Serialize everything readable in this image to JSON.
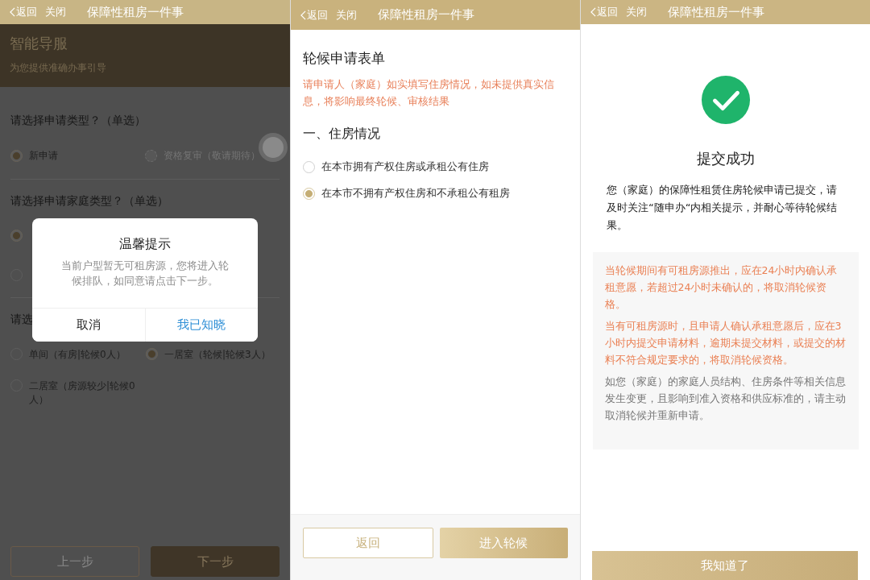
{
  "guide_screen": {
    "header": {
      "back": "返回",
      "close": "关闭",
      "title": "保障性租房一件事"
    },
    "banner": {
      "title": "智能导服",
      "subtitle": "为您提供准确办事引导"
    },
    "questions": [
      {
        "label": "请选择申请类型？（单选）",
        "options": [
          {
            "label": "新申请",
            "selected": true,
            "disabled": false
          },
          {
            "label": "资格复审（敬请期待）",
            "selected": false,
            "disabled": true
          }
        ]
      },
      {
        "label": "请选择申请家庭类型？（单选）",
        "options": [
          {
            "selected": true
          },
          {
            "selected": false
          }
        ]
      },
      {
        "label": "请选",
        "options": [
          {
            "label": "单间（有房|轮候0人）",
            "selected": false
          },
          {
            "label": "一居室（轮候|轮候3人）",
            "selected": true
          },
          {
            "label": "二居室（房源较少|轮候0人）",
            "selected": false
          }
        ]
      }
    ],
    "buttons": {
      "prev": "上一步",
      "next": "下一步"
    },
    "dialog": {
      "title": "温馨提示",
      "message": "当前户型暂无可租房源，您将进入轮候排队，如同意请点击下一步。",
      "cancel": "取消",
      "confirm": "我已知晓"
    }
  },
  "form_screen": {
    "header": {
      "back": "返回",
      "close": "关闭",
      "title": "保障性租房一件事"
    },
    "title": "轮候申请表单",
    "notice": "请申请人（家庭）如实填写住房情况，如未提供真实信息，将影响最终轮候、审核结果",
    "section": "一、住房情况",
    "options": [
      {
        "label": "在本市拥有产权住房或承租公有住房",
        "selected": false
      },
      {
        "label": "在本市不拥有产权住房和不承租公有租房",
        "selected": true
      }
    ],
    "buttons": {
      "back": "返回",
      "enter": "进入轮候"
    }
  },
  "success_screen": {
    "header": {
      "back": "返回",
      "close": "关闭",
      "title": "保障性租房一件事"
    },
    "title": "提交成功",
    "message": "您（家庭）的保障性租赁住房轮候申请已提交，请及时关注“随申办“内相关提示，并耐心等待轮候结果。",
    "notes": [
      {
        "text": "当轮候期间有可租房源推出，应在24小时内确认承租意愿，若超过24小时未确认的，将取消轮候资格。",
        "kind": "warning"
      },
      {
        "text": "当有可租房源时，且申请人确认承租意愿后，应在3小时内提交申请材料，逾期未提交材料，或提交的材料不符合规定要求的，将取消轮候资格。",
        "kind": "warning"
      },
      {
        "text": "如您（家庭）的家庭人员结构、住房条件等相关信息发生变更，且影响到准入资格和供应标准的，请主动取消轮候并重新申请。",
        "kind": "info"
      }
    ],
    "button": "我知道了"
  }
}
